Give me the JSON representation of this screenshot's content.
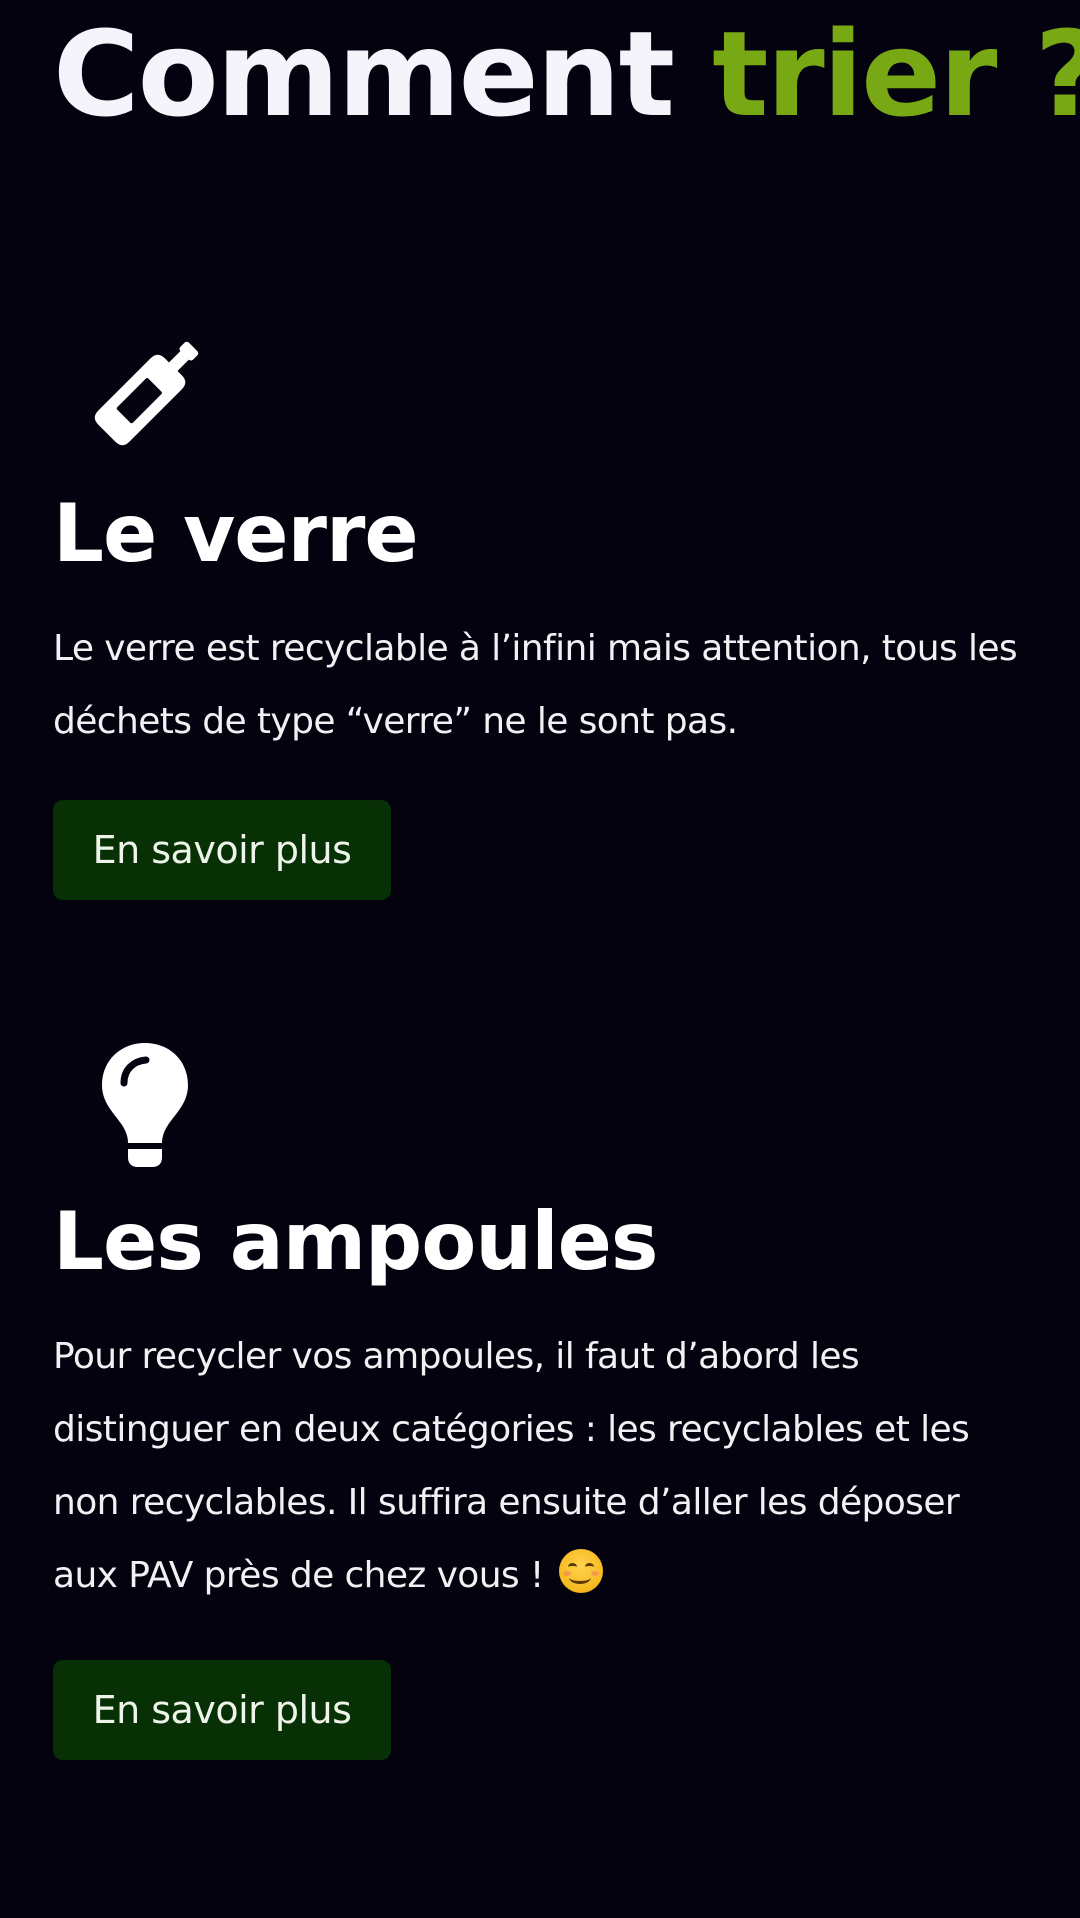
{
  "header": {
    "title_main": "Comment ",
    "title_accent": "trier ?"
  },
  "colors": {
    "background": "#04020f",
    "accent": "#78a814",
    "button_bg": "#073104"
  },
  "cards": [
    {
      "icon": "bottle-icon",
      "title": "Le verre",
      "text": "Le verre est recyclable à l’infini mais attention, tous les déchets de type “verre” ne le sont pas.",
      "button_label": "En savoir plus"
    },
    {
      "icon": "lightbulb-icon",
      "title": "Les ampoules",
      "text": "Pour recycler vos ampoules, il faut d’abord les distinguer en deux catégories : les recyclables et les non recyclables. Il suffira ensuite d’aller les déposer aux PAV près de chez vous !",
      "emoji": "smiling-face-emoji",
      "button_label": "En savoir plus"
    }
  ]
}
